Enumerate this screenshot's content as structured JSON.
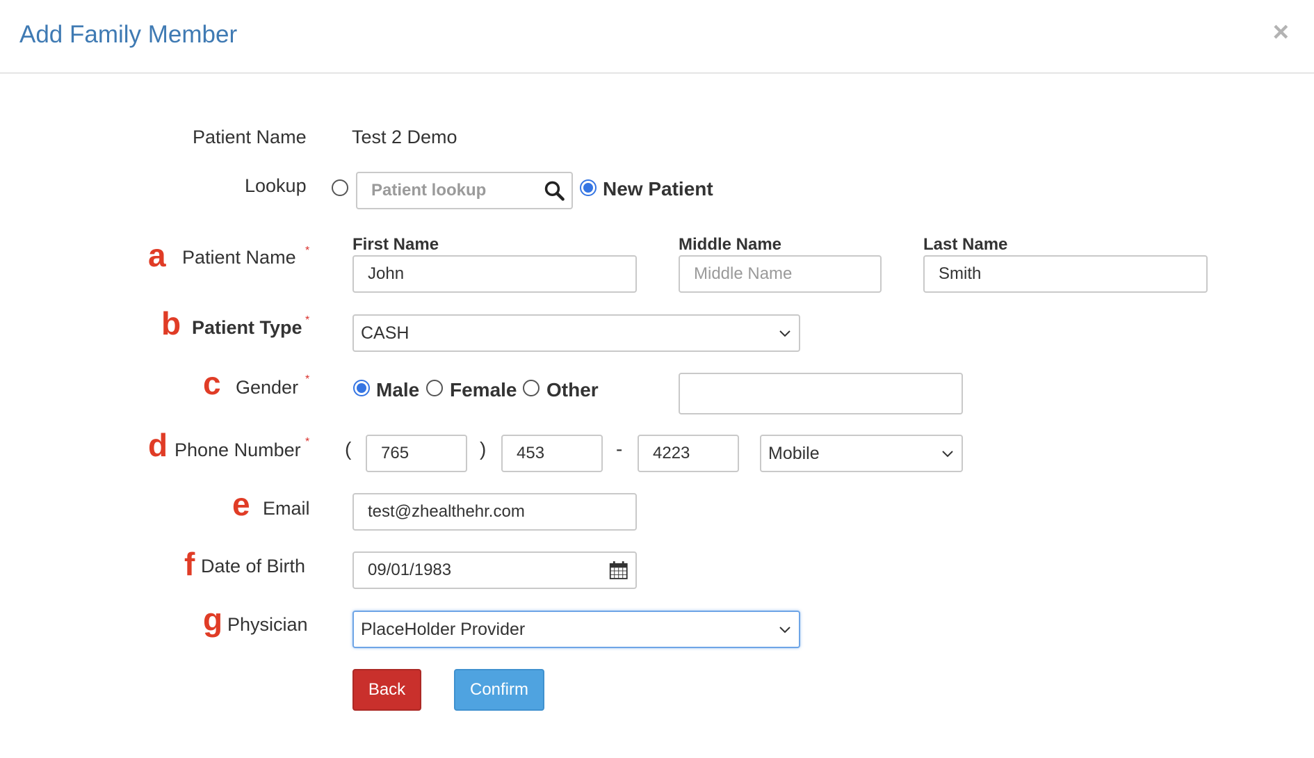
{
  "header": {
    "title": "Add Family Member",
    "close": "×"
  },
  "patient": {
    "label": "Patient Name",
    "value": "Test 2 Demo"
  },
  "lookup": {
    "label": "Lookup",
    "placeholder": "Patient lookup",
    "new_patient_label": "New Patient",
    "selected": "new_patient"
  },
  "steps": {
    "a": "a",
    "b": "b",
    "c": "c",
    "d": "d",
    "e": "e",
    "f": "f",
    "g": "g"
  },
  "required_mark": "*",
  "name": {
    "label": "Patient Name",
    "first_label": "First Name",
    "first_value": "John",
    "middle_label": "Middle Name",
    "middle_placeholder": "Middle Name",
    "middle_value": "",
    "last_label": "Last Name",
    "last_value": "Smith"
  },
  "patient_type": {
    "label": "Patient Type",
    "value": "CASH"
  },
  "gender": {
    "label": "Gender",
    "options": [
      "Male",
      "Female",
      "Other"
    ],
    "selected": "Male",
    "other_value": ""
  },
  "phone": {
    "label": "Phone Number",
    "open_paren": "(",
    "close_paren": ")",
    "dash": "-",
    "area": "765",
    "prefix": "453",
    "line": "4223",
    "type": "Mobile"
  },
  "email": {
    "label": "Email",
    "value": "test@zhealthehr.com"
  },
  "dob": {
    "label": "Date of Birth",
    "value": "09/01/1983"
  },
  "physician": {
    "label": "Physician",
    "value": "PlaceHolder Provider"
  },
  "buttons": {
    "back": "Back",
    "confirm": "Confirm"
  },
  "colors": {
    "title": "#3f7ab3",
    "step": "#e03c26",
    "back": "#c9302c",
    "confirm": "#4fa3e0",
    "radio": "#3575e3"
  }
}
